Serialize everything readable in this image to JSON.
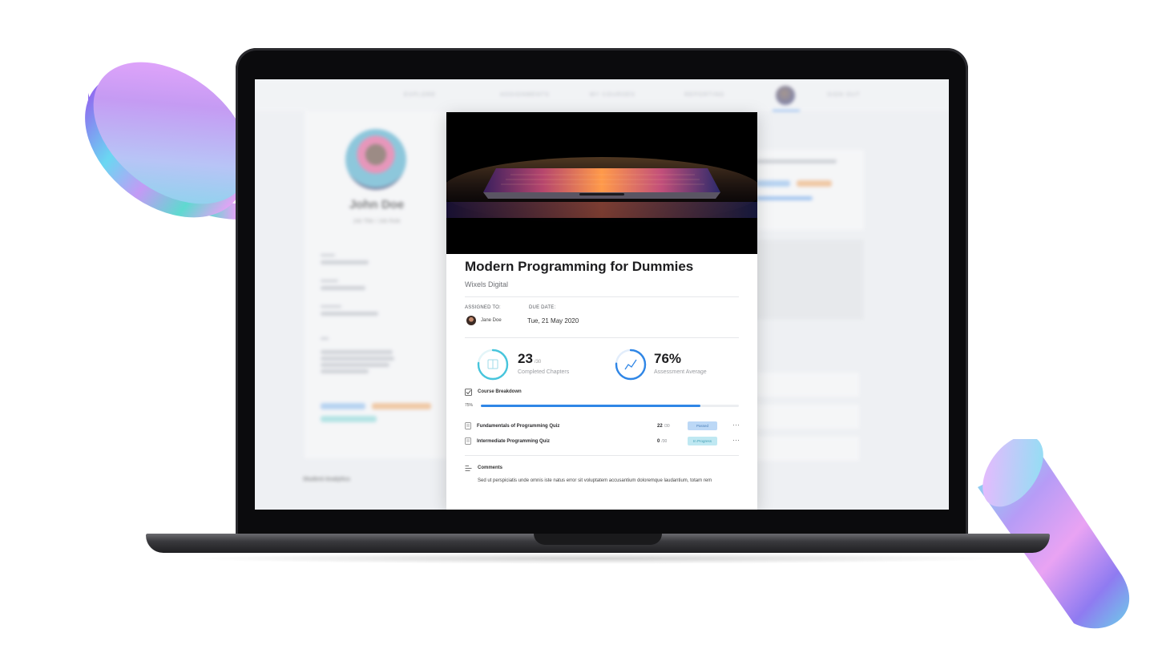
{
  "background_app": {
    "nav": [
      "EXPLORE",
      "ASSIGNMENTS",
      "MY COURSES",
      "REPORTING",
      "SIGN OUT"
    ],
    "profile": {
      "name": "John Doe",
      "subtitle": "Job Title / Job Role"
    },
    "analytics_heading": "Student Analytics"
  },
  "modal": {
    "title": "Modern Programming for Dummies",
    "publisher": "Wixels Digital",
    "assigned_to_label": "ASSIGNED TO:",
    "assigned_to": "Jane Doe",
    "due_date_label": "DUE DATE:",
    "due_date": "Tue, 21 May 2020",
    "stats": {
      "chapters_value": "23",
      "chapters_total": "/30",
      "chapters_label": "Completed Chapters",
      "chapters_fraction": 0.7667,
      "assessment_value": "76%",
      "assessment_label": "Assessment Average",
      "assessment_fraction": 0.76
    },
    "breakdown": {
      "title": "Course Breakdown",
      "progress_label": "75%",
      "progress_fraction": 0.85
    },
    "quizzes": [
      {
        "name": "Fundamentals of Programming Quiz",
        "score": "22",
        "total": "/30",
        "status": "Passed",
        "status_color": "#bcd8f6",
        "status_text_color": "#4a7fb8"
      },
      {
        "name": "Intermediate Programming Quiz",
        "score": "0",
        "total": "/30",
        "status": "In Progress",
        "status_color": "#bfe8f2",
        "status_text_color": "#3f9db3"
      }
    ],
    "comments": {
      "title": "Comments",
      "text": "Sed ut perspiciatis unde omnis iste natus error sit voluptatem accusantium doloremque laudantium, totam rem"
    }
  },
  "colors": {
    "accent": "#2f86e6",
    "teal": "#47c5dc"
  }
}
